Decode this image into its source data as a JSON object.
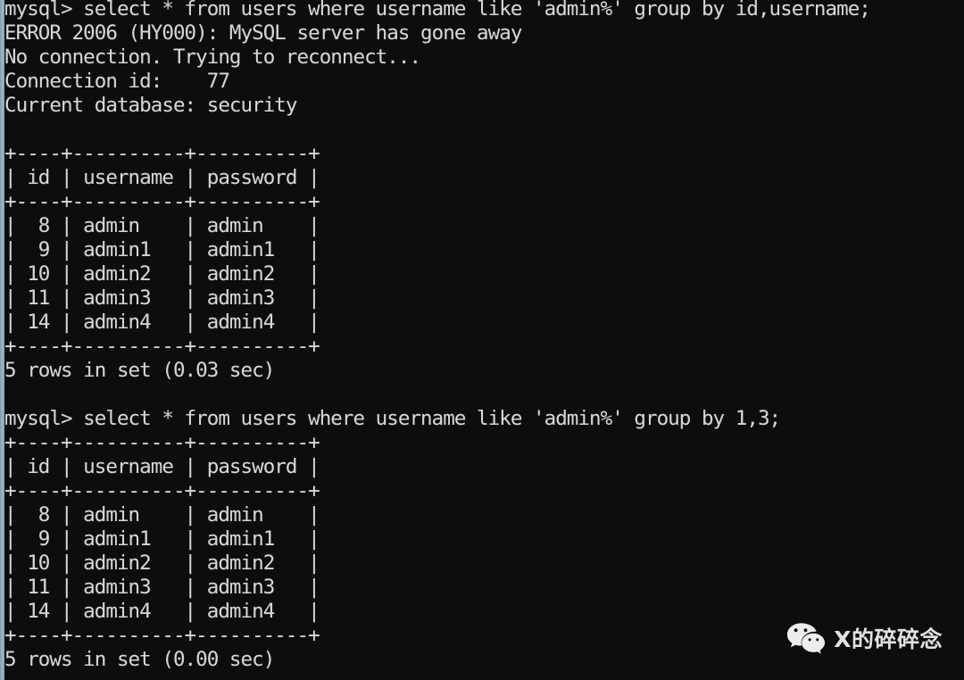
{
  "terminal": {
    "background_color": "#0d0d0d",
    "text_color": "#d6d6d6",
    "scrollbar_color": "#8fa8c0",
    "lines": [
      "mysql> select * from users where username like 'admin%' group by id,username;",
      "ERROR 2006 (HY000): MySQL server has gone away",
      "No connection. Trying to reconnect...",
      "Connection id:    77",
      "Current database: security",
      "",
      "+----+----------+----------+",
      "| id | username | password |",
      "+----+----------+----------+",
      "|  8 | admin    | admin    |",
      "|  9 | admin1   | admin1   |",
      "| 10 | admin2   | admin2   |",
      "| 11 | admin3   | admin3   |",
      "| 14 | admin4   | admin4   |",
      "+----+----------+----------+",
      "5 rows in set (0.03 sec)",
      "",
      "mysql> select * from users where username like 'admin%' group by 1,3;",
      "+----+----------+----------+",
      "| id | username | password |",
      "+----+----------+----------+",
      "|  8 | admin    | admin    |",
      "|  9 | admin1   | admin1   |",
      "| 10 | admin2   | admin2   |",
      "| 11 | admin3   | admin3   |",
      "| 14 | admin4   | admin4   |",
      "+----+----------+----------+",
      "5 rows in set (0.00 sec)"
    ],
    "queries": [
      {
        "prompt": "mysql>",
        "sql": "select * from users where username like 'admin%' group by id,username;",
        "error": "ERROR 2006 (HY000): MySQL server has gone away",
        "reconnect_notice": "No connection. Trying to reconnect...",
        "connection_id_label": "Connection id:",
        "connection_id": "77",
        "current_database_label": "Current database:",
        "current_database": "security",
        "result_footer": "5 rows in set (0.03 sec)"
      },
      {
        "prompt": "mysql>",
        "sql": "select * from users where username like 'admin%' group by 1,3;",
        "result_footer": "5 rows in set (0.00 sec)"
      }
    ],
    "result_table": {
      "columns": [
        "id",
        "username",
        "password"
      ],
      "rows": [
        [
          "8",
          "admin",
          "admin"
        ],
        [
          "9",
          "admin1",
          "admin1"
        ],
        [
          "10",
          "admin2",
          "admin2"
        ],
        [
          "11",
          "admin3",
          "admin3"
        ],
        [
          "14",
          "admin4",
          "admin4"
        ]
      ],
      "row_count": 5
    }
  },
  "watermark": {
    "icon": "wechat-logo-icon",
    "text": "X的碎碎念"
  }
}
